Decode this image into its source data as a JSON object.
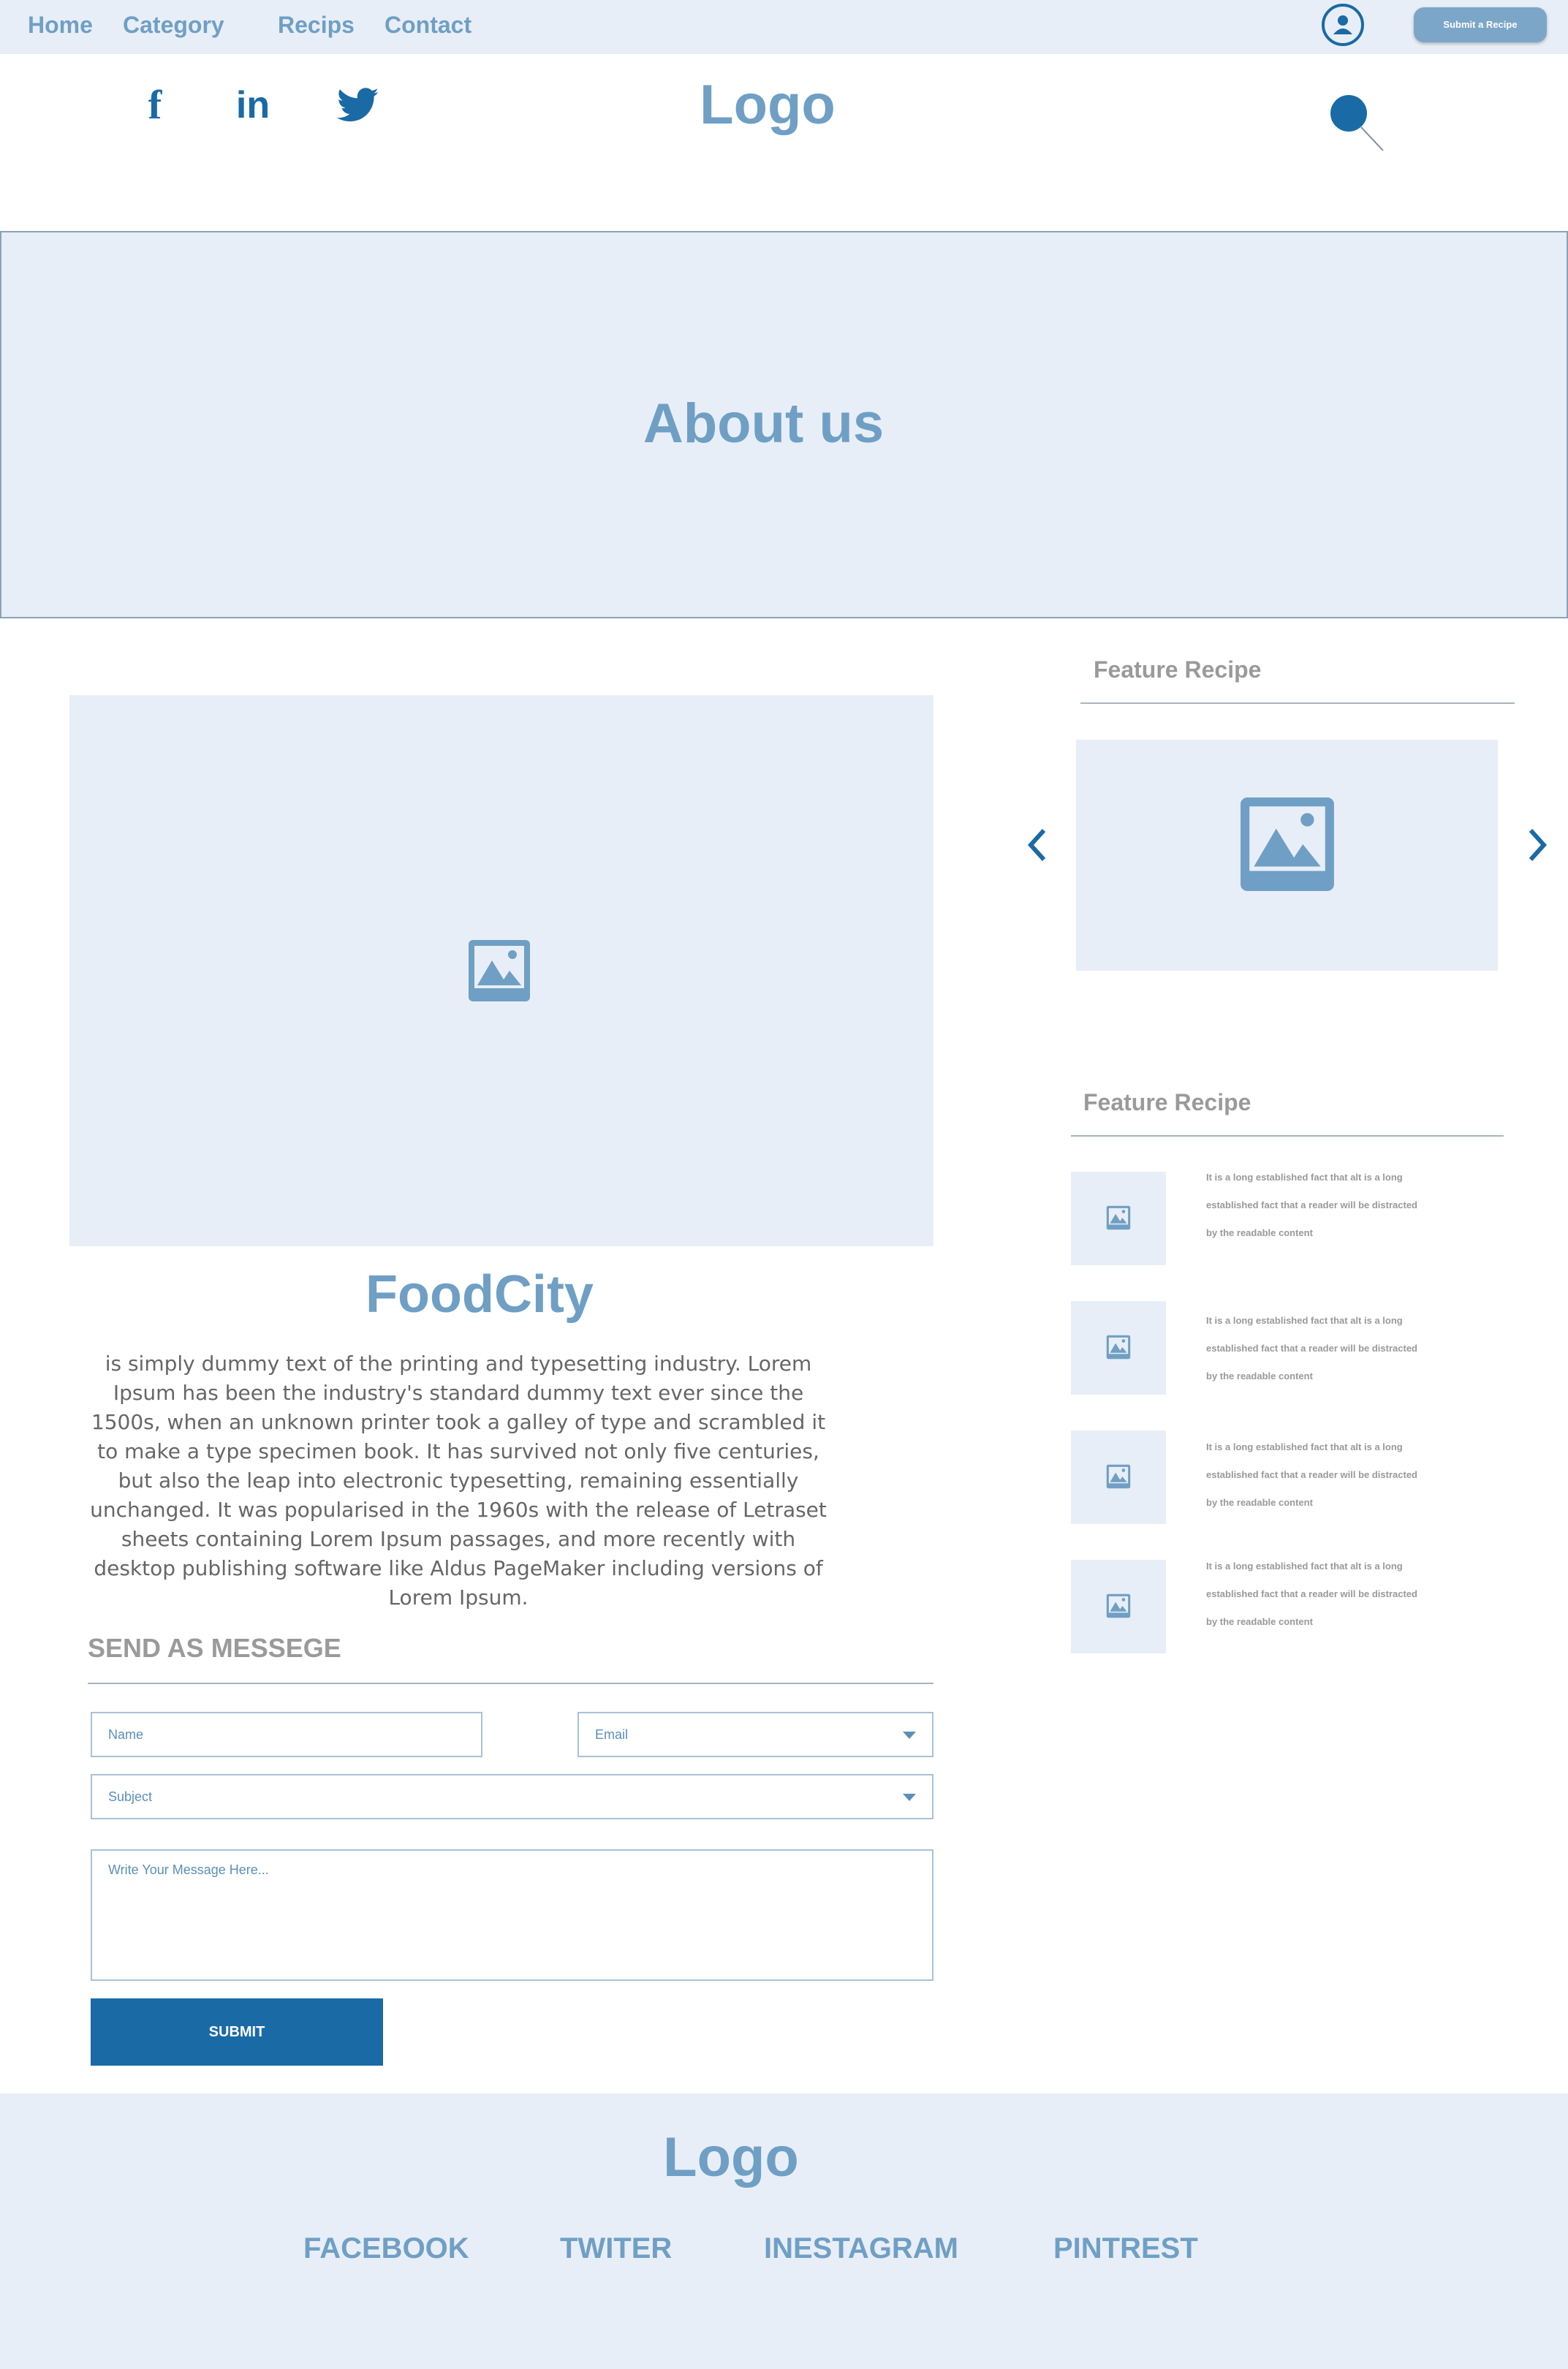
{
  "nav": {
    "home": "Home",
    "category": "Category",
    "recipes": "Recips",
    "contact": "Contact"
  },
  "submit_recipe": "Submit a Recipe",
  "header": {
    "logo": "Logo"
  },
  "social": {
    "facebook_glyph": "f",
    "linkedin_glyph": "in"
  },
  "hero": {
    "title": "About us"
  },
  "brand": {
    "name": "FoodCity"
  },
  "about_text": "is simply dummy text of the printing and typesetting industry. Lorem Ipsum has been the industry's standard dummy text ever since the 1500s, when an unknown printer took a galley of type and scrambled it to make a type specimen book. It has survived not only five centuries, but also the leap into electronic typesetting, remaining essentially unchanged. It was popularised in the 1960s with the release of Letraset sheets containing Lorem Ipsum passages, and more recently with desktop publishing software like Aldus PageMaker including versions of Lorem Ipsum.",
  "form": {
    "title": "SEND AS MESSEGE",
    "name_placeholder": "Name",
    "email_placeholder": "Email",
    "subject_placeholder": "Subject",
    "message_placeholder": "Write Your Message Here...",
    "submit": "SUBMIT"
  },
  "sidebar": {
    "feature_title_1": "Feature Recipe",
    "feature_title_2": "Feature Recipe",
    "items": [
      {
        "text": "It is a long established fact that alt is a long established fact that a reader will be distracted by the readable content"
      },
      {
        "text": "It is a long established fact that alt is a long established fact that a reader will be distracted by the readable content"
      },
      {
        "text": "It is a long established fact that alt is a long established fact that a reader will be distracted by the readable content"
      },
      {
        "text": "It is a long established fact that alt is a long established fact that a reader will be distracted by the readable content"
      }
    ]
  },
  "footer": {
    "logo": "Logo",
    "links": [
      "FACEBOOK",
      "TWITER",
      "INESTAGRAM",
      "PINTREST"
    ]
  },
  "colors": {
    "accent": "#1a6aa6",
    "light_blue": "#6f9fc4",
    "panel": "#e8eef7"
  }
}
